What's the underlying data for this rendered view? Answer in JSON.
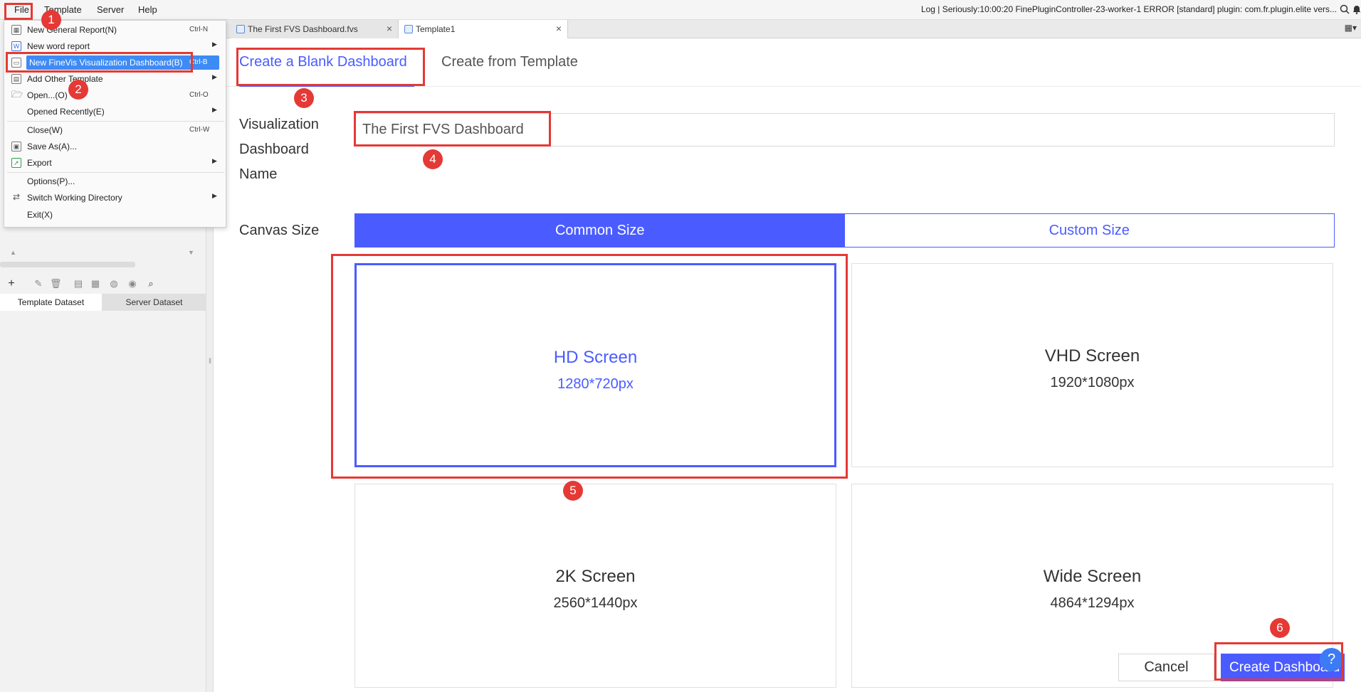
{
  "menubar": {
    "items": [
      "File",
      "Template",
      "Server",
      "Help"
    ],
    "log_text": "Log | Seriously:10:00:20 FinePluginController-23-worker-1 ERROR [standard] plugin: com.fr.plugin.elite vers..."
  },
  "tabs": [
    {
      "label": "The First FVS Dashboard.fvs",
      "close": "×"
    },
    {
      "label": "Template1",
      "close": "×"
    }
  ],
  "file_menu": {
    "items": [
      {
        "label": "New General Report(N)",
        "shortcut": "Ctrl-N",
        "submenu": false,
        "icon": "grid-icon"
      },
      {
        "label": "New word report",
        "shortcut": "",
        "submenu": true,
        "icon": "word-icon"
      },
      {
        "label": "New FineVis Visualization Dashboard(B)",
        "shortcut": "Ctrl-B",
        "submenu": false,
        "icon": "dashboard-icon"
      },
      {
        "label": "Add Other Template",
        "shortcut": "",
        "submenu": true,
        "icon": "template-icon"
      },
      {
        "label": "Open...(O)",
        "shortcut": "Ctrl-O",
        "submenu": false,
        "icon": "folder-icon"
      },
      {
        "label": "Opened Recently(E)",
        "shortcut": "",
        "submenu": true,
        "icon": ""
      },
      {
        "label": "Close(W)",
        "shortcut": "Ctrl-W",
        "submenu": false,
        "icon": ""
      },
      {
        "label": "Save As(A)...",
        "shortcut": "",
        "submenu": false,
        "icon": "save-icon"
      },
      {
        "label": "Export",
        "shortcut": "",
        "submenu": true,
        "icon": "export-icon"
      },
      {
        "label": "Options(P)...",
        "shortcut": "",
        "submenu": false,
        "icon": ""
      },
      {
        "label": "Switch Working Directory",
        "shortcut": "",
        "submenu": true,
        "icon": "switch-icon"
      },
      {
        "label": "Exit(X)",
        "shortcut": "",
        "submenu": false,
        "icon": ""
      }
    ]
  },
  "dataset": {
    "tabs": [
      "Template Dataset",
      "Server Dataset"
    ]
  },
  "dialog": {
    "tab_blank": "Create a Blank Dashboard",
    "tab_template": "Create from Template",
    "name_label": [
      "Visualization",
      "Dashboard",
      "Name"
    ],
    "name_value": "The First FVS Dashboard",
    "canvas_label": "Canvas Size",
    "size_common": "Common Size",
    "size_custom": "Custom Size",
    "cards": [
      {
        "title": "HD Screen",
        "size": "1280*720px",
        "selected": true
      },
      {
        "title": "VHD Screen",
        "size": "1920*1080px",
        "selected": false
      },
      {
        "title": "2K Screen",
        "size": "2560*1440px",
        "selected": false
      },
      {
        "title": "Wide Screen",
        "size": "4864*1294px",
        "selected": false
      }
    ],
    "cancel": "Cancel",
    "create": "Create Dashboard",
    "help": "?"
  },
  "annotations": [
    "1",
    "2",
    "3",
    "4",
    "5",
    "6"
  ],
  "colors": {
    "accent": "#4a5cff",
    "highlight": "#e53935",
    "help": "#3d7bf5"
  }
}
